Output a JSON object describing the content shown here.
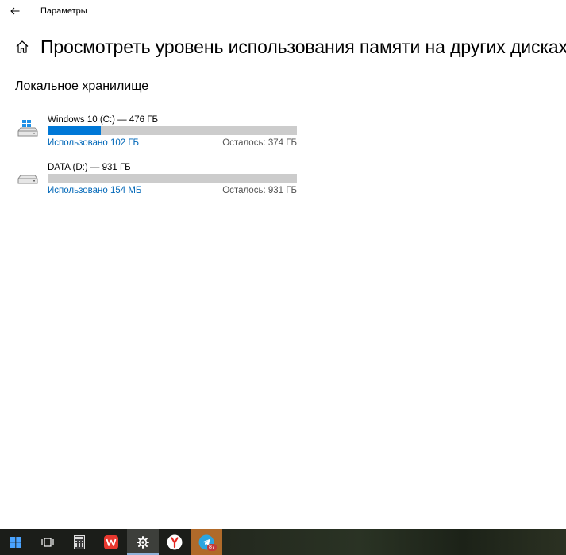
{
  "window": {
    "app_title": "Параметры",
    "back_icon": "arrow-left-icon"
  },
  "page": {
    "title": "Просмотреть уровень использования памяти на других дисках",
    "home_icon": "home-icon"
  },
  "section": {
    "title": "Локальное хранилище"
  },
  "drives": [
    {
      "name": "Windows 10 (C:) — 476 ГБ",
      "icon": "windows-drive-icon",
      "used_label": "Использовано 102 ГБ",
      "free_label": "Осталось: 374 ГБ",
      "used_fraction": 0.214
    },
    {
      "name": "DATA (D:) — 931 ГБ",
      "icon": "hard-drive-icon",
      "used_label": "Использовано 154 МБ",
      "free_label": "Осталось: 931 ГБ",
      "used_fraction": 0.0002
    }
  ],
  "taskbar": {
    "items": [
      {
        "name": "start-button",
        "icon": "windows-logo-icon"
      },
      {
        "name": "task-view-button",
        "icon": "task-view-icon"
      },
      {
        "name": "calculator-button",
        "icon": "calculator-icon"
      },
      {
        "name": "wps-office-button",
        "icon": "wps-office-icon"
      },
      {
        "name": "settings-button",
        "icon": "gear-icon",
        "active": true
      },
      {
        "name": "yandex-browser-button",
        "icon": "yandex-icon"
      },
      {
        "name": "telegram-button",
        "icon": "telegram-icon",
        "badge": "87"
      }
    ]
  },
  "colors": {
    "accent": "#0078d7",
    "link": "#0067b8",
    "bar_empty": "#cccccc",
    "taskbar": "#1b1d19"
  }
}
